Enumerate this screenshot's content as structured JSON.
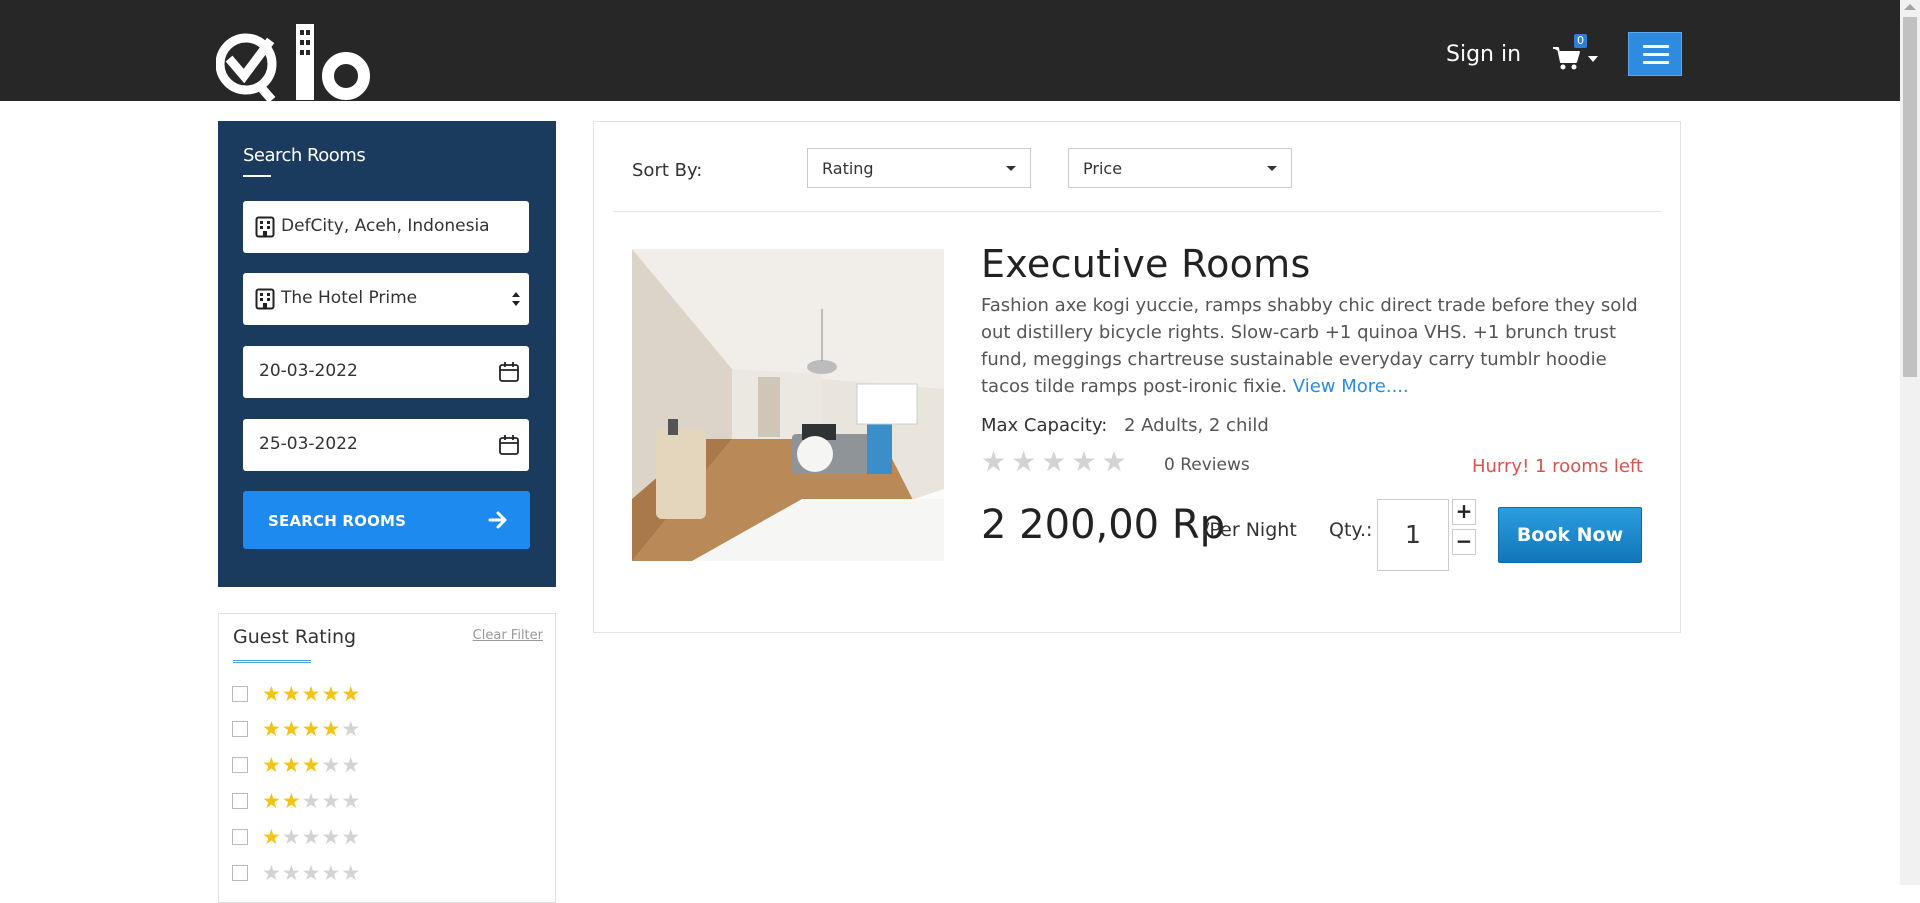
{
  "header": {
    "signin_label": "Sign in",
    "cart_count": "0"
  },
  "search": {
    "title": "Search Rooms",
    "location": "DefCity, Aceh, Indonesia",
    "hotel": "The Hotel Prime",
    "checkin": "20-03-2022",
    "checkout": "25-03-2022",
    "button_label": "SEARCH ROOMS"
  },
  "guest_rating": {
    "title": "Guest Rating",
    "clear_label": "Clear Filter",
    "options": [
      5,
      4,
      3,
      2,
      1,
      0
    ]
  },
  "sort": {
    "label": "Sort By:",
    "rating_value": "Rating",
    "price_value": "Price"
  },
  "room": {
    "title": "Executive Rooms",
    "description": "Fashion axe kogi yuccie, ramps shabby chic direct trade before they sold out distillery bicycle rights. Slow-carb +1 quinoa VHS. +1 brunch trust fund, meggings chartreuse sustainable everyday carry tumblr hoodie tacos tilde ramps post-ironic fixie. ",
    "view_more": "View More....",
    "capacity_label": "Max Capacity:",
    "capacity_value": "2 Adults, 2 child",
    "rating_stars": 0,
    "reviews": "0 Reviews",
    "availability": "Hurry! 1 rooms left",
    "price": "2 200,00 Rp",
    "per_night": "/Per Night",
    "qty_label": "Qty.:",
    "qty_value": "1",
    "book_label": "Book Now"
  },
  "colors": {
    "header_bg": "#272727",
    "search_panel_bg": "#1a3a5e",
    "accent_blue": "#1c8aee",
    "star_on": "#f2c418",
    "alert_red": "#d9534f"
  }
}
